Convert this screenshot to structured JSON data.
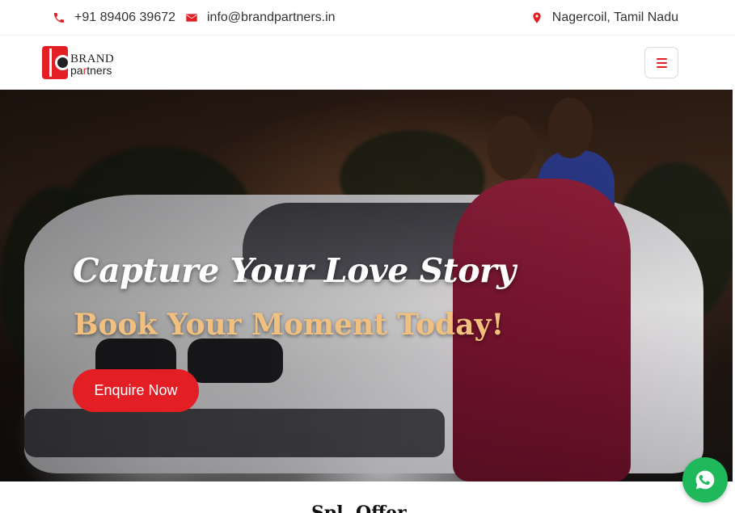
{
  "topbar": {
    "phone": "+91 89406 39672",
    "email": "info@brandpartners.in",
    "location": "Nagercoil, Tamil Nadu",
    "icons": {
      "phone": "phone-icon",
      "email": "envelope-icon",
      "location": "map-pin-icon"
    }
  },
  "navbar": {
    "logo": {
      "brand": "BRAND",
      "partners_pre": "pa",
      "partners_accent": "r",
      "partners_post": "tners"
    },
    "menu_icon": "hamburger-menu-icon"
  },
  "hero": {
    "title": "Capture Your Love Story",
    "subtitle": "Book Your Moment Today!",
    "cta_label": "Enquire Now"
  },
  "next_section": {
    "heading_peek": "Spl. Offer"
  },
  "floating": {
    "whatsapp_icon": "whatsapp-icon"
  },
  "colors": {
    "accent": "#e31e24",
    "subtitle_gold": "#f2c07e",
    "whatsapp_green": "#1fb85a"
  }
}
